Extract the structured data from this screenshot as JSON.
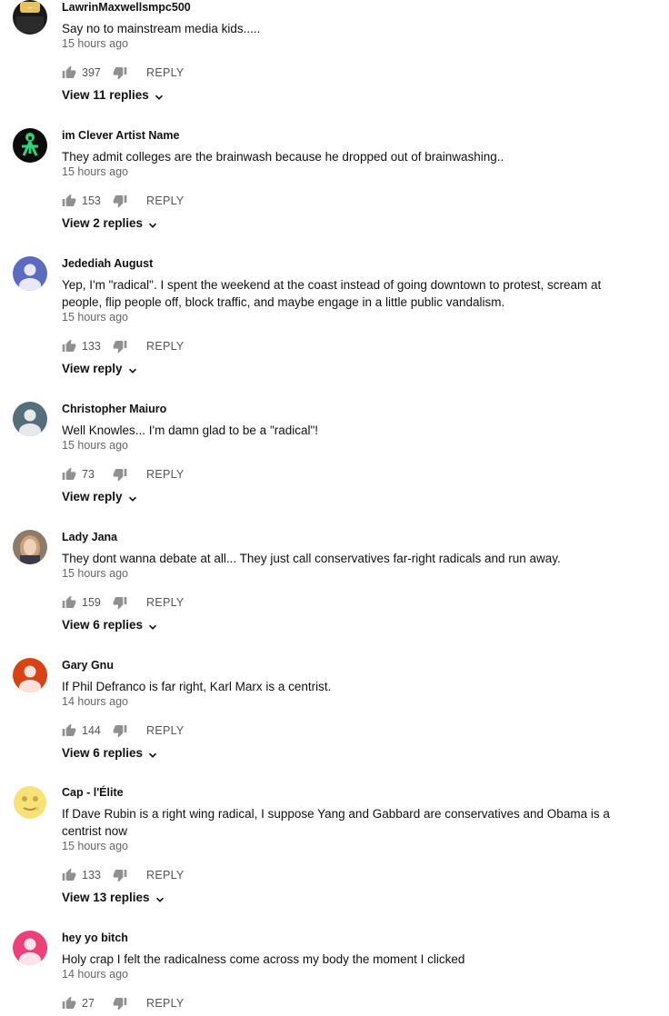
{
  "comments": [
    {
      "author": "LawrinMaxwellsmpc500",
      "text": "Say no to mainstream media kids.....",
      "time": "15 hours ago",
      "likes": "397",
      "reply_label": "REPLY",
      "view_replies": "View 11 replies",
      "avatar": "yellow-logo",
      "text_lines": 1
    },
    {
      "author": "im Clever Artist Name",
      "text": "They admit colleges are the brainwash because he dropped out of brainwashing..",
      "time": "15 hours ago",
      "likes": "153",
      "reply_label": "REPLY",
      "view_replies": "View 2 replies",
      "avatar": "green-figure",
      "text_lines": 1
    },
    {
      "author": "Jedediah August",
      "text": "Yep, I'm \"radical\". I spent the weekend at the coast instead of going downtown to protest, scream at people, flip people off, block traffic, and maybe engage in a little public vandalism.",
      "time": "15 hours ago",
      "likes": "133",
      "reply_label": "REPLY",
      "view_replies": "View reply",
      "avatar": "default-blue",
      "text_lines": 2
    },
    {
      "author": "Christopher Maiuro",
      "text": "Well Knowles... I'm damn glad to be a \"radical\"!",
      "time": "15 hours ago",
      "likes": "73",
      "reply_label": "REPLY",
      "view_replies": "View reply",
      "avatar": "default-slate",
      "text_lines": 1
    },
    {
      "author": "Lady Jana",
      "text": "They dont wanna debate at all... They just call conservatives far-right radicals and run away.",
      "time": "15 hours ago",
      "likes": "159",
      "reply_label": "REPLY",
      "view_replies": "View 6 replies",
      "avatar": "photo-woman",
      "text_lines": 1
    },
    {
      "author": "Gary Gnu",
      "text": "If Phil Defranco is far right, Karl Marx is a centrist.",
      "time": "14 hours ago",
      "likes": "144",
      "reply_label": "REPLY",
      "view_replies": "View 6 replies",
      "avatar": "default-orange",
      "text_lines": 1
    },
    {
      "author": "Cap - l'Élite",
      "text": "If Dave Rubin is a right wing radical, I suppose Yang and Gabbard are conservatives and Obama is a centrist now",
      "time": "15 hours ago",
      "likes": "133",
      "reply_label": "REPLY",
      "view_replies": "View 13 replies",
      "avatar": "moon-face",
      "text_lines": 2
    },
    {
      "author": "hey yo bitch",
      "text": "Holy crap I felt the radicalness come across my body the moment I clicked",
      "time": "14 hours ago",
      "likes": "27",
      "reply_label": "REPLY",
      "view_replies": "",
      "avatar": "default-pink",
      "text_lines": 1
    }
  ],
  "colors": {
    "default-blue": "#5c6bc0",
    "default-slate": "#546e7a",
    "default-orange": "#d84315",
    "default-pink": "#ec407a",
    "meta_text": "#666666",
    "icon": "#909090"
  }
}
